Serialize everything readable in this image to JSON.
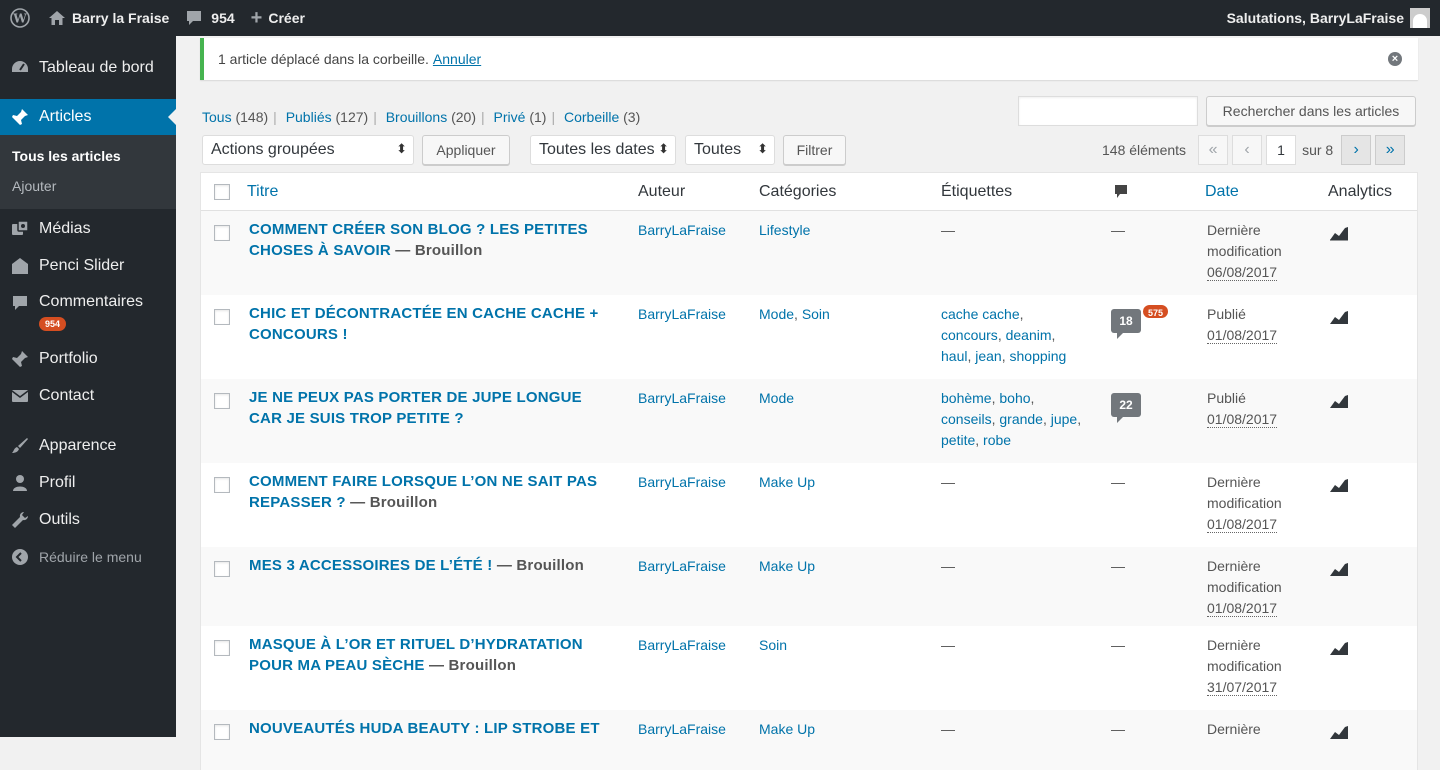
{
  "adminbar": {
    "site_name": "Barry la Fraise",
    "comments_count": "954",
    "new_label": "Créer",
    "greeting": "Salutations, BarryLaFraise"
  },
  "sidebar": {
    "dashboard": "Tableau de bord",
    "articles": "Articles",
    "submenu": {
      "all": "Tous les articles",
      "add": "Ajouter"
    },
    "media": "Médias",
    "penci": "Penci Slider",
    "comments": "Commentaires",
    "comments_badge": "954",
    "portfolio": "Portfolio",
    "contact": "Contact",
    "appearance": "Apparence",
    "profile": "Profil",
    "tools": "Outils",
    "collapse": "Réduire le menu"
  },
  "notice": {
    "message": "1 article déplacé dans la corbeille.",
    "undo": "Annuler"
  },
  "filters": {
    "all": "Tous",
    "all_count": "(148)",
    "published": "Publiés",
    "published_count": "(127)",
    "drafts": "Brouillons",
    "drafts_count": "(20)",
    "private": "Privé",
    "private_count": "(1)",
    "trash": "Corbeille",
    "trash_count": "(3)"
  },
  "search": {
    "placeholder": "",
    "button": "Rechercher dans les articles"
  },
  "toolbar": {
    "bulk_actions": "Actions groupées",
    "apply": "Appliquer",
    "dates": "Toutes les dates",
    "categories": "Toutes",
    "filter": "Filtrer"
  },
  "pagination": {
    "items": "148 éléments",
    "first": "«",
    "prev": "‹",
    "current": "1",
    "of": "sur 8",
    "next": "›",
    "last": "»"
  },
  "columns": {
    "title": "Titre",
    "author": "Auteur",
    "categories": "Catégories",
    "tags": "Étiquettes",
    "date": "Date",
    "analytics": "Analytics"
  },
  "rows": [
    {
      "title_l1": "COMMENT CRÉER SON BLOG ? LES PETITES",
      "title_l2": "CHOSES À SAVOIR",
      "state": "— Brouillon",
      "author": "BarryLaFraise",
      "categories": [
        "Lifestyle"
      ],
      "tags": "—",
      "comments": "—",
      "date_status_l1": "Dernière",
      "date_status_l2": "modification",
      "date": "06/08/2017"
    },
    {
      "title_l1": "CHIC ET DÉCONTRACTÉE EN CACHE CACHE +",
      "title_l2": "CONCOURS !",
      "state": "",
      "author": "BarryLaFraise",
      "categories": [
        "Mode",
        "Soin"
      ],
      "tags_l1": [
        "cache cache"
      ],
      "tags_l2": [
        "concours",
        "deanim"
      ],
      "tags_l3": [
        "haul",
        "jean",
        "shopping"
      ],
      "comments_bubble": "18",
      "comments_pending": "575",
      "date_status_l1": "Publié",
      "date": "01/08/2017"
    },
    {
      "title_l1": "JE NE PEUX PAS PORTER DE JUPE LONGUE",
      "title_l2": "CAR JE SUIS TROP PETITE ?",
      "state": "",
      "author": "BarryLaFraise",
      "categories": [
        "Mode"
      ],
      "tags_l1": [
        "bohème",
        "boho"
      ],
      "tags_l2": [
        "conseils",
        "grande",
        "jupe"
      ],
      "tags_l3": [
        "petite",
        "robe"
      ],
      "comments_bubble": "22",
      "date_status_l1": "Publié",
      "date": "01/08/2017"
    },
    {
      "title_l1": "COMMENT FAIRE LORSQUE L’ON NE SAIT PAS",
      "title_l2": "REPASSER ?",
      "state": "— Brouillon",
      "author": "BarryLaFraise",
      "categories": [
        "Make Up"
      ],
      "tags": "—",
      "comments": "—",
      "date_status_l1": "Dernière",
      "date_status_l2": "modification",
      "date": "01/08/2017"
    },
    {
      "title_l1": "MES 3 ACCESSOIRES DE L’ÉTÉ !",
      "state": "— Brouillon",
      "author": "BarryLaFraise",
      "categories": [
        "Make Up"
      ],
      "tags": "—",
      "comments": "—",
      "date_status_l1": "Dernière",
      "date_status_l2": "modification",
      "date": "01/08/2017"
    },
    {
      "title_l1": "MASQUE À L’OR ET RITUEL D’HYDRATATION",
      "title_l2": "POUR MA PEAU SÈCHE",
      "state": "— Brouillon",
      "author": "BarryLaFraise",
      "categories": [
        "Soin"
      ],
      "tags": "—",
      "comments": "—",
      "date_status_l1": "Dernière",
      "date_status_l2": "modification",
      "date": "31/07/2017"
    },
    {
      "title_l1": "NOUVEAUTÉS HUDA BEAUTY : LIP STROBE ET",
      "author": "BarryLaFraise",
      "categories": [
        "Make Up"
      ],
      "tags": "—",
      "comments": "—",
      "date_status_l1": "Dernière"
    }
  ]
}
